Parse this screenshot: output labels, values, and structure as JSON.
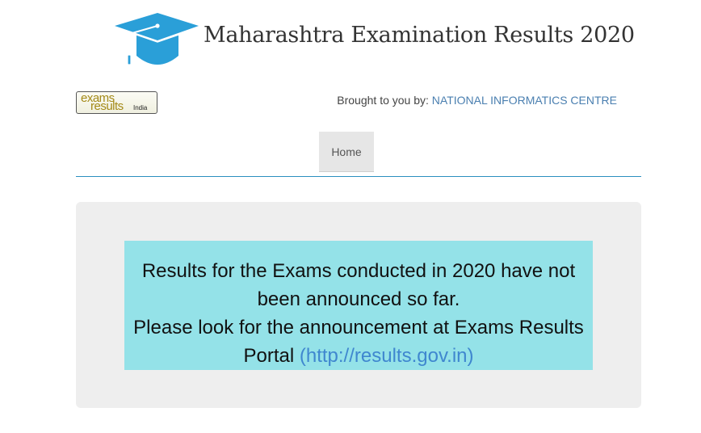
{
  "header": {
    "icon": "graduation-cap-icon",
    "title": "Maharashtra Examination Results 2020"
  },
  "logo": {
    "line1": "exams",
    "line2": "results",
    "suffix": "India"
  },
  "credit": {
    "prefix": "Brought to you by:",
    "organization": "NATIONAL INFORMATICS CENTRE"
  },
  "nav": {
    "items": [
      {
        "label": "Home"
      }
    ]
  },
  "notice": {
    "line1": "Results for the Exams conducted in 2020 have not been announced so far.",
    "line2": "Please look for the announcement at Exams Results Portal",
    "link_text": "(http://results.gov.in)"
  },
  "colors": {
    "accent": "#2a8fbf",
    "cap": "#2a9fd8",
    "notice_bg": "#94e2e8",
    "link": "#3f87cf",
    "logo_text": "#a48a18",
    "panel_bg": "#eeeeee"
  }
}
